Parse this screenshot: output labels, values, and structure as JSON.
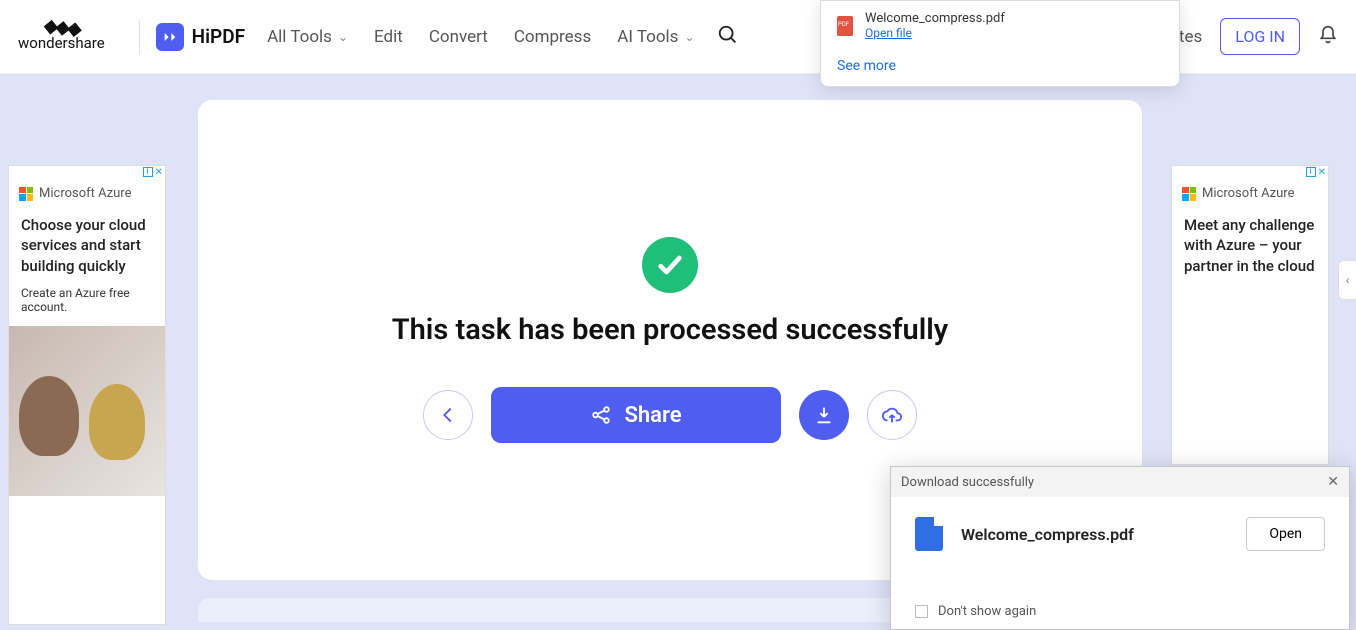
{
  "header": {
    "brand_name": "wondershare",
    "product": "HiPDF",
    "nav": {
      "all_tools": "All Tools",
      "edit": "Edit",
      "convert": "Convert",
      "compress": "Compress",
      "ai_tools": "AI Tools"
    },
    "templates": "Templates",
    "login": "LOG IN"
  },
  "main": {
    "title": "This task has been processed successfully",
    "share_label": "Share"
  },
  "ads": {
    "brand": "Microsoft Azure",
    "left_body": "Choose your cloud services and start building quickly",
    "left_sub": "Create an Azure free account.",
    "right_body": "Meet any challenge with Azure – your partner in the cloud"
  },
  "download_dropdown": {
    "filename": "Welcome_compress.pdf",
    "open": "Open file",
    "see_more": "See more"
  },
  "done_panel": {
    "title": "Download successfully",
    "filename": "Welcome_compress.pdf",
    "open": "Open",
    "dont_show": "Don't show again"
  }
}
